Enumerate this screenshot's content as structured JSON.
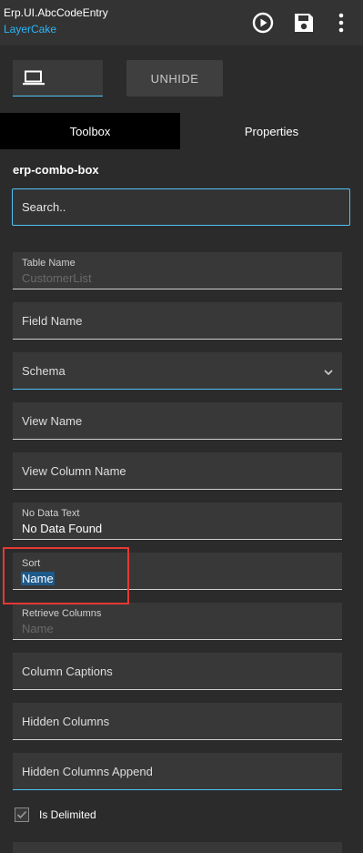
{
  "header": {
    "title": "Erp.UI.AbcCodeEntry",
    "subtitle": "LayerCake",
    "icons": [
      "play-circle-icon",
      "save-icon",
      "more-vert-icon"
    ]
  },
  "toolbar": {
    "device_icon": "laptop-icon",
    "unhide_label": "UNHIDE"
  },
  "tabs": [
    {
      "label": "Toolbox",
      "active": true
    },
    {
      "label": "Properties",
      "active": false
    }
  ],
  "component": {
    "name": "erp-combo-box"
  },
  "search": {
    "placeholder": "Search.."
  },
  "properties": [
    {
      "label": "Table Name",
      "value": "CustomerList",
      "placeholder_value": true
    },
    {
      "label": "Field Name"
    },
    {
      "label": "Schema",
      "dropdown": true
    },
    {
      "label": "View Name"
    },
    {
      "label": "View Column Name"
    },
    {
      "label": "No Data Text",
      "value": "No Data Found"
    },
    {
      "label": "Sort",
      "value": "Name",
      "selected": true
    },
    {
      "label": "Retrieve Columns",
      "value": "Name",
      "placeholder_value": true
    },
    {
      "label": "Column Captions"
    },
    {
      "label": "Hidden Columns"
    },
    {
      "label": "Hidden Columns Append"
    }
  ],
  "is_delimited": {
    "label": "Is Delimited",
    "checked": true
  },
  "colors": {
    "accent": "#4fc3f7",
    "subtitle": "#29b6f6",
    "highlight": "#e53935",
    "selection": "#1e5a8a"
  }
}
